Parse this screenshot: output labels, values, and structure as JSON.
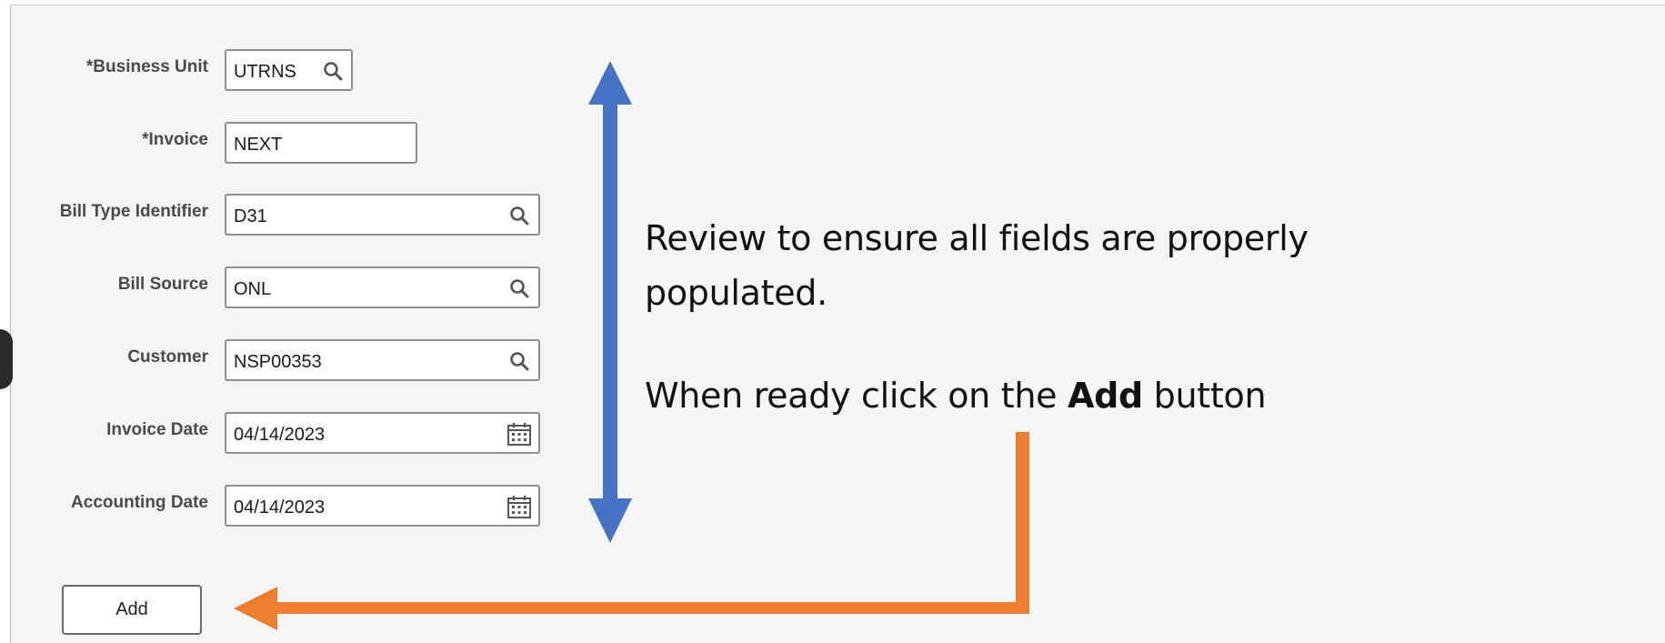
{
  "form": {
    "fields": [
      {
        "label": "*Business Unit",
        "value": "UTRNS",
        "icon": "search-icon"
      },
      {
        "label": "*Invoice",
        "value": "NEXT",
        "icon": ""
      },
      {
        "label": "Bill Type Identifier",
        "value": "D31",
        "icon": "search-icon"
      },
      {
        "label": "Bill Source",
        "value": "ONL",
        "icon": "search-icon"
      },
      {
        "label": "Customer",
        "value": "NSP00353",
        "icon": "search-icon"
      },
      {
        "label": "Invoice Date",
        "value": "04/14/2023",
        "icon": "calendar-icon"
      },
      {
        "label": "Accounting Date",
        "value": "04/14/2023",
        "icon": "calendar-icon"
      }
    ],
    "add_label": "Add"
  },
  "annotation": {
    "line1": "Review to ensure all fields are properly",
    "line2": "populated.",
    "line3_prefix": "When ready click on the ",
    "line3_bold": "Add",
    "line3_suffix": " button"
  },
  "colors": {
    "blue_arrow": "#4472C4",
    "orange_arrow": "#ED7D31"
  }
}
